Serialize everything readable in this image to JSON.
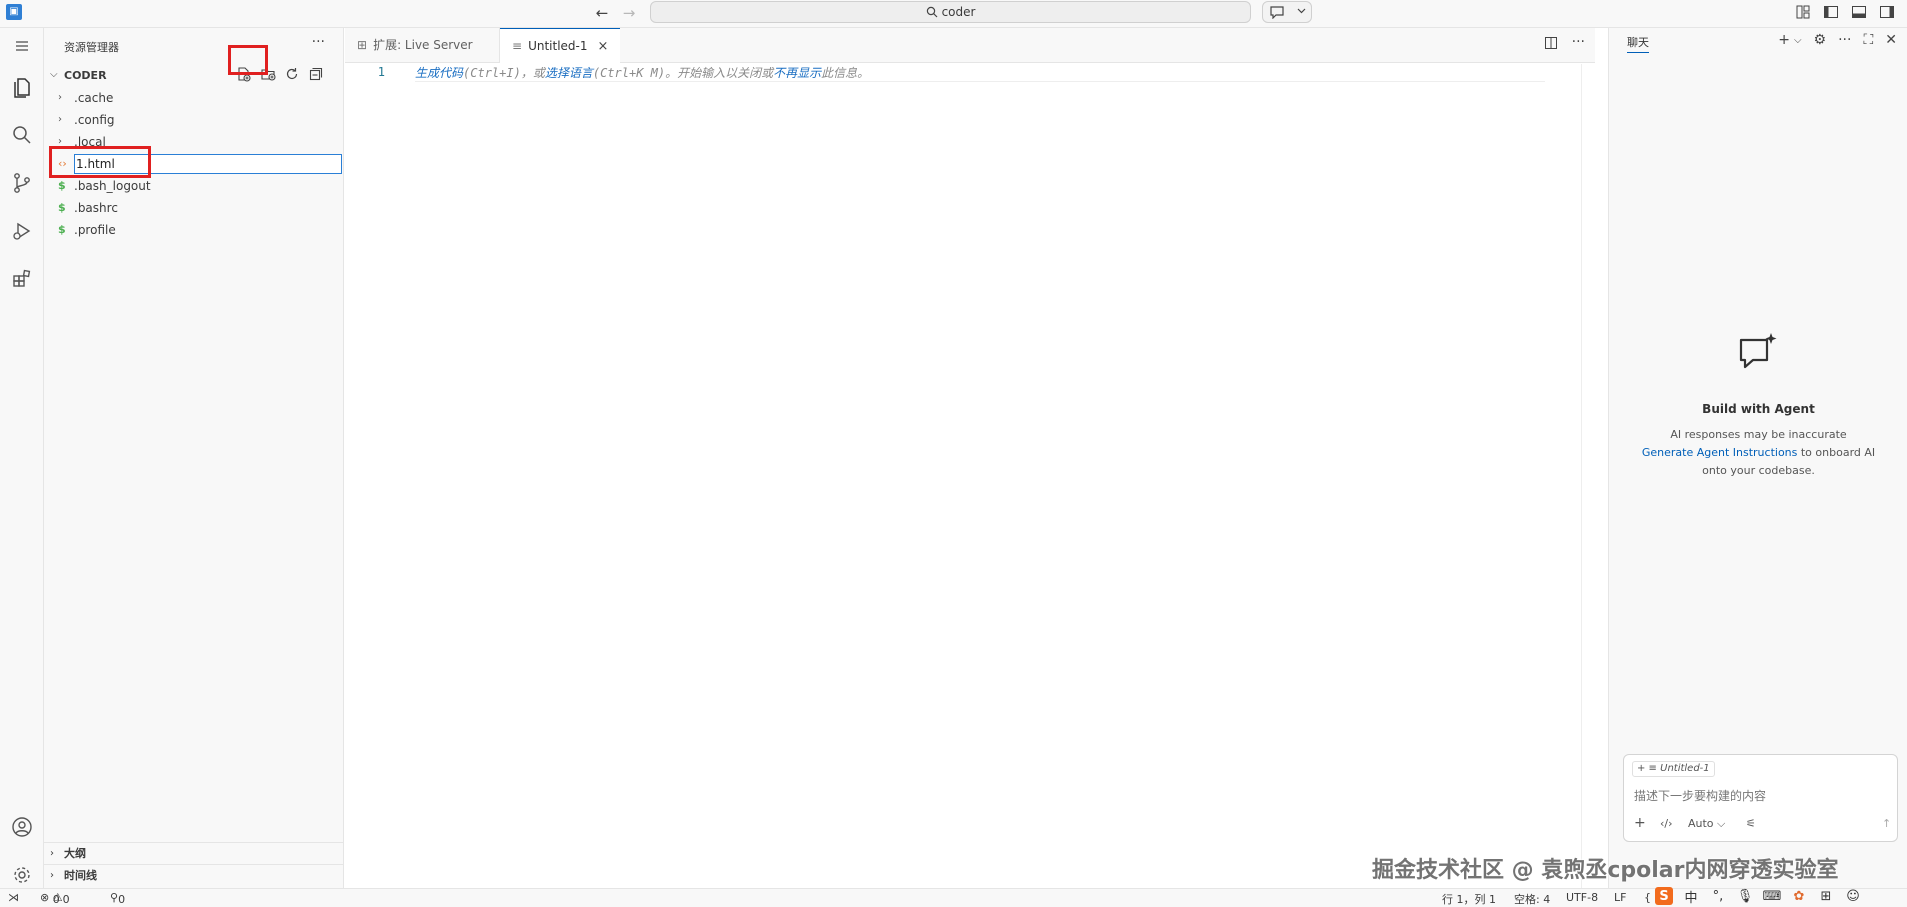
{
  "titlebar": {
    "back_label": "←",
    "forward_label": "→",
    "search_text": "coder"
  },
  "sidebar": {
    "title": "资源管理器",
    "more_label": "···",
    "folder_name": "CODER",
    "tree": [
      {
        "label": ".cache",
        "kind": "folder"
      },
      {
        "label": ".config",
        "kind": "folder"
      },
      {
        "label": ".local",
        "kind": "folder"
      },
      {
        "label": "1.html",
        "kind": "renaming"
      },
      {
        "label": ".bash_logout",
        "kind": "file"
      },
      {
        "label": ".bashrc",
        "kind": "file"
      },
      {
        "label": ".profile",
        "kind": "file"
      }
    ],
    "rename_value": "1.html",
    "outline_label": "大纲",
    "timeline_label": "时间线"
  },
  "tabs": {
    "inactive_label": "扩展: Live Server",
    "active_label": "Untitled-1",
    "close_label": "×"
  },
  "editor": {
    "line_number": "1",
    "hint": {
      "link1": "生成代码",
      "text1": "(Ctrl+I)，或",
      "link2": "选择语言",
      "text2": "(Ctrl+K M)。开始输入以关闭或",
      "link3": "不再显示",
      "text3": "此信息。"
    }
  },
  "chat": {
    "tab_label": "聊天",
    "title": "Build with Agent",
    "line1": "AI responses may be inaccurate",
    "link": "Generate Agent Instructions",
    "line2_rest": " to onboard AI",
    "line3": "onto your codebase.",
    "chip_label": "Untitled-1",
    "placeholder": "描述下一步要构建的内容",
    "mode_label": "Auto ⌵"
  },
  "statusbar": {
    "errors": "0",
    "warnings": "0",
    "ports": "0",
    "position": "行 1，列 1",
    "spaces": "空格: 4",
    "encoding": "UTF-8",
    "eol": "LF",
    "lang_brace": "{"
  },
  "watermark": "掘金技术社区 @ 袁煦丞cpolar内网穿透实验室",
  "ime": {
    "lang": "中"
  },
  "colors": {
    "accent": "#005fb8",
    "highlight": "#e02020",
    "link": "#1a6ec2"
  }
}
